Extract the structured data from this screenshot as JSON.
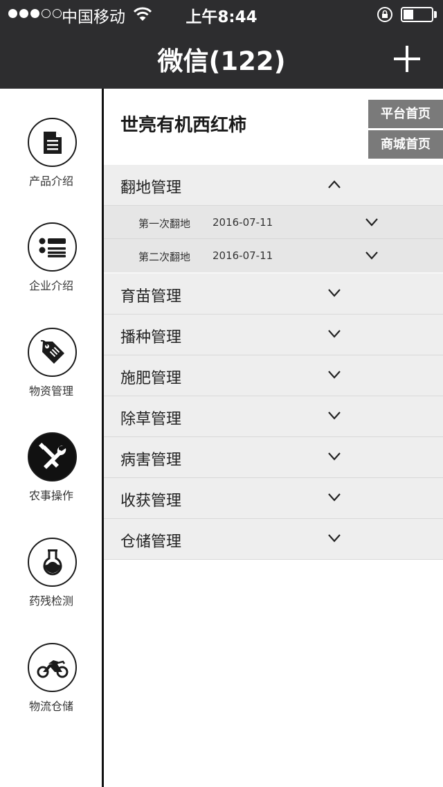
{
  "status_bar": {
    "carrier": "中国移动",
    "time": "上午8:44",
    "signal_bars": 3,
    "signal_total": 5,
    "battery_level": 0.3
  },
  "nav": {
    "title": "微信(122)",
    "action_icon": "plus-icon"
  },
  "sidebar": {
    "items": [
      {
        "label": "产品介绍",
        "icon": "document-icon",
        "active": false
      },
      {
        "label": "企业介绍",
        "icon": "list-icon",
        "active": false
      },
      {
        "label": "物资管理",
        "icon": "tag-icon",
        "active": false
      },
      {
        "label": "农事操作",
        "icon": "tools-icon",
        "active": true
      },
      {
        "label": "药残检测",
        "icon": "flask-icon",
        "active": false
      },
      {
        "label": "物流仓储",
        "icon": "motorcycle-icon",
        "active": false
      }
    ]
  },
  "main": {
    "product_title": "世亮有机西红柿",
    "platform_home": "平台首页",
    "mall_home": "商城首页",
    "sections": [
      {
        "label": "翻地管理",
        "expanded": true,
        "entries": [
          {
            "label": "第一次翻地",
            "date": "2016-07-11"
          },
          {
            "label": "第二次翻地",
            "date": "2016-07-11"
          }
        ]
      },
      {
        "label": "育苗管理",
        "expanded": false
      },
      {
        "label": "播种管理",
        "expanded": false
      },
      {
        "label": "施肥管理",
        "expanded": false
      },
      {
        "label": "除草管理",
        "expanded": false
      },
      {
        "label": "病害管理",
        "expanded": false
      },
      {
        "label": "收获管理",
        "expanded": false
      },
      {
        "label": "仓储管理",
        "expanded": false
      }
    ]
  },
  "colors": {
    "bar_background": "#2d2d2f",
    "accordion_background": "#eeeeee",
    "sub_background": "#e6e6e6",
    "quick_button": "#7a7a7a"
  }
}
